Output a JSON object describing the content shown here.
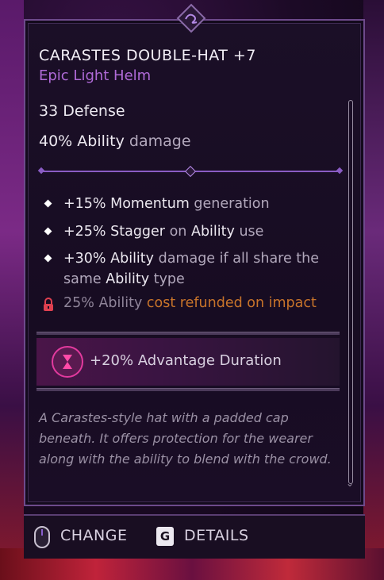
{
  "item": {
    "name": "CARASTES DOUBLE-HAT +7",
    "type": "Epic Light Helm",
    "defense_value": "33",
    "defense_label": "Defense",
    "ability_value": "40% Ability",
    "ability_label": "damage"
  },
  "perks": [
    {
      "bold": "+15% Momentum",
      "rest": "generation"
    },
    {
      "bold": "+25% Stagger",
      "mid": "on",
      "bold2": "Ability",
      "rest": "use"
    },
    {
      "bold": "+30% Ability",
      "rest": "damage if all share the",
      "line2a": "same",
      "line2b": "Ability",
      "line2c": "type"
    }
  ],
  "locked_perk": {
    "prefix": "25% Ability",
    "rest": "cost refunded on impact"
  },
  "advantage": {
    "text": "+20% Advantage Duration"
  },
  "description": "A Carastes-style hat with a padded cap beneath. It offers protection for the wearer along with the ability to blend with the crowd.",
  "footer": {
    "change_label": "CHANGE",
    "details_key": "G",
    "details_label": "DETAILS"
  },
  "colors": {
    "accent_purple": "#b06ad8",
    "locked_orange": "#c8742a",
    "advantage_pink": "#e23a9e"
  }
}
